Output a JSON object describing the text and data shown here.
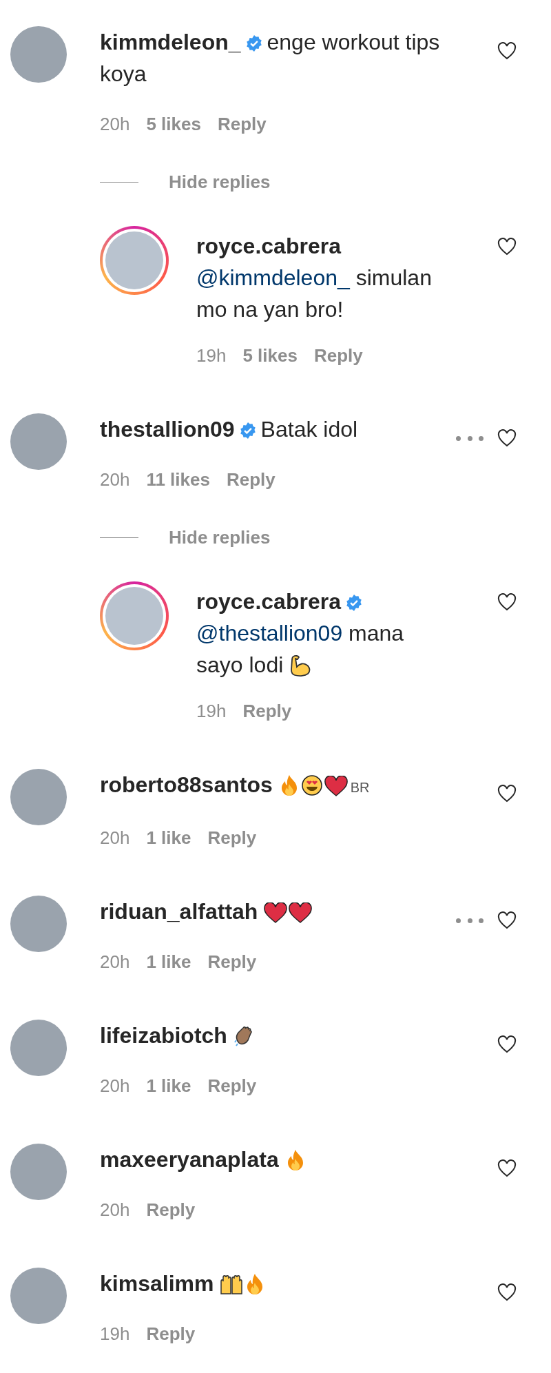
{
  "comments": [
    {
      "username": "kimmdeleon_",
      "verified": true,
      "text": "enge workout tips koya",
      "time": "20h",
      "likes": "5 likes",
      "reply": "Reply",
      "options_visible": false,
      "replies_toggle": "Hide replies",
      "replies": [
        {
          "username": "royce.cabrera",
          "verified": false,
          "story_ring": true,
          "mention": "@kimmdeleon_",
          "text": "simulan mo na yan bro!",
          "time": "19h",
          "likes": "5 likes",
          "reply": "Reply"
        }
      ]
    },
    {
      "username": "thestallion09",
      "verified": true,
      "text": "Batak idol",
      "time": "20h",
      "likes": "11 likes",
      "reply": "Reply",
      "options_visible": true,
      "replies_toggle": "Hide replies",
      "replies": [
        {
          "username": "royce.cabrera",
          "verified": true,
          "story_ring": true,
          "mention": "@thestallion09",
          "text": "mana sayo lodi",
          "reactions": [
            {
              "kind": "flexed-arm"
            }
          ],
          "time": "19h",
          "reply": "Reply"
        }
      ]
    },
    {
      "username": "roberto88santos",
      "verified": false,
      "reactions": [
        {
          "kind": "fire"
        },
        {
          "kind": "heart-eyes"
        },
        {
          "kind": "heart"
        }
      ],
      "suffix": "BR",
      "time": "20h",
      "likes": "1 like",
      "reply": "Reply",
      "options_visible": false
    },
    {
      "username": "riduan_alfattah",
      "verified": false,
      "reactions": [
        {
          "kind": "heart"
        },
        {
          "kind": "heart"
        }
      ],
      "time": "20h",
      "likes": "1 like",
      "reply": "Reply",
      "options_visible": true
    },
    {
      "username": "lifeizabiotch",
      "verified": false,
      "reactions": [
        {
          "kind": "clap"
        }
      ],
      "time": "20h",
      "likes": "1 like",
      "reply": "Reply",
      "options_visible": false
    },
    {
      "username": "maxeeryanaplata",
      "verified": false,
      "reactions": [
        {
          "kind": "fire"
        }
      ],
      "time": "20h",
      "reply": "Reply",
      "options_visible": false
    },
    {
      "username": "kimsalimm",
      "verified": false,
      "reactions": [
        {
          "kind": "raised-hands"
        },
        {
          "kind": "fire"
        }
      ],
      "time": "19h",
      "reply": "Reply",
      "options_visible": false
    }
  ]
}
